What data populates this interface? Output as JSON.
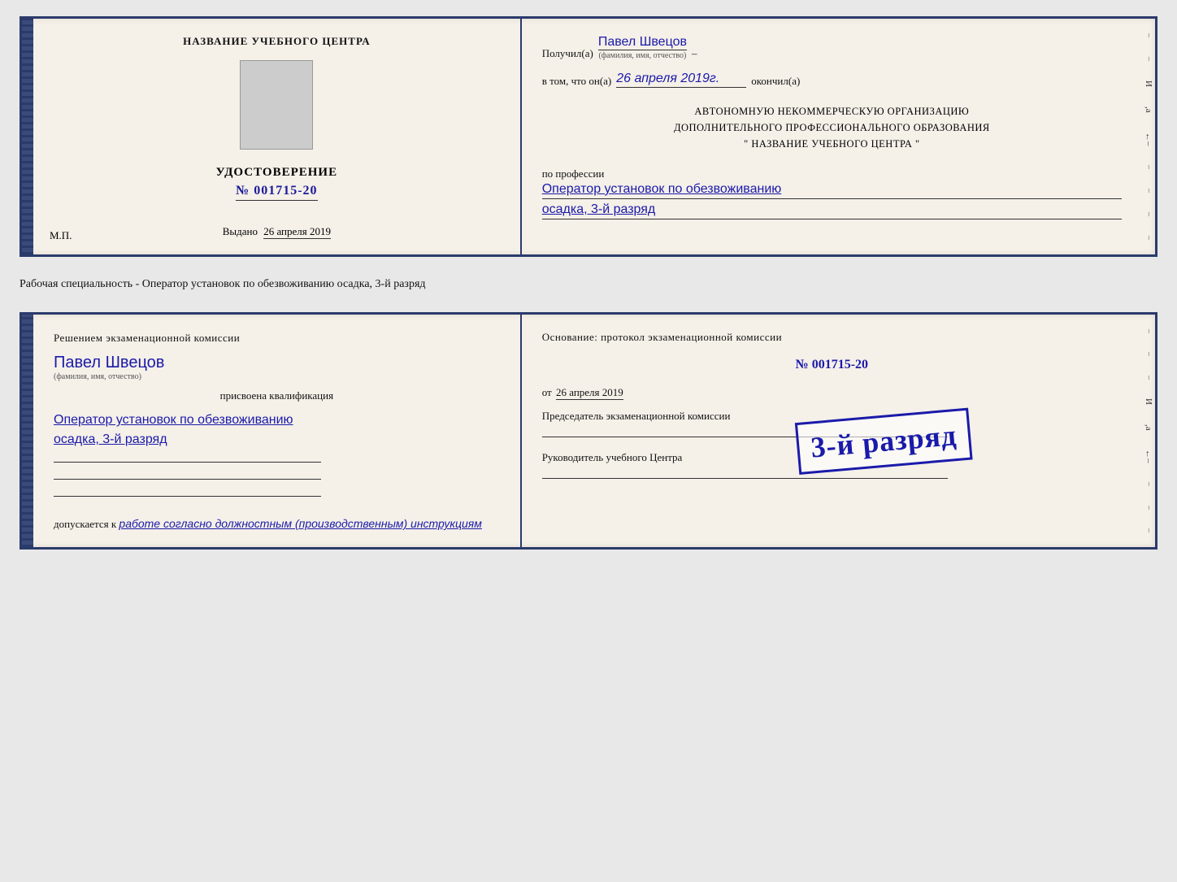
{
  "top_doc": {
    "left": {
      "center_title": "НАЗВАНИЕ УЧЕБНОГО ЦЕНТРА",
      "cert_label": "УДОСТОВЕРЕНИЕ",
      "cert_number": "№ 001715-20",
      "issued_label": "Выдано",
      "issued_date": "26 апреля 2019",
      "mp_label": "М.П."
    },
    "right": {
      "received_label": "Получил(а)",
      "person_name": "Павел Швецов",
      "name_hint": "(фамилия, имя, отчество)",
      "in_that_label": "в том, что он(а)",
      "completion_date": "26 апреля 2019г.",
      "finished_label": "окончил(а)",
      "org_line1": "АВТОНОМНУЮ НЕКОММЕРЧЕСКУЮ ОРГАНИЗАЦИЮ",
      "org_line2": "ДОПОЛНИТЕЛЬНОГО ПРОФЕССИОНАЛЬНОГО ОБРАЗОВАНИЯ",
      "org_line3": "\"   НАЗВАНИЕ УЧЕБНОГО ЦЕНТРА   \"",
      "profession_label": "по профессии",
      "profession_value": "Оператор установок по обезвоживанию",
      "rank_value": "осадка, 3-й разряд"
    }
  },
  "separator": {
    "text": "Рабочая специальность - Оператор установок по обезвоживанию осадка, 3-й разряд"
  },
  "bottom_doc": {
    "left": {
      "commission_text": "Решением экзаменационной комиссии",
      "person_name": "Павел Швецов",
      "name_hint": "(фамилия, имя, отчество)",
      "assigned_label": "присвоена квалификация",
      "profession_line1": "Оператор установок по обезвоживанию",
      "profession_line2": "осадка, 3-й разряд",
      "admission_label": "допускается к",
      "admission_value": "работе согласно должностным (производственным) инструкциям"
    },
    "right": {
      "basis_label": "Основание: протокол экзаменационной комиссии",
      "protocol_number": "№  001715-20",
      "from_label": "от",
      "from_date": "26 апреля 2019",
      "chairman_label": "Председатель экзаменационной комиссии",
      "director_label": "Руководитель учебного Центра"
    },
    "stamp": {
      "text": "3-й разряд"
    }
  }
}
